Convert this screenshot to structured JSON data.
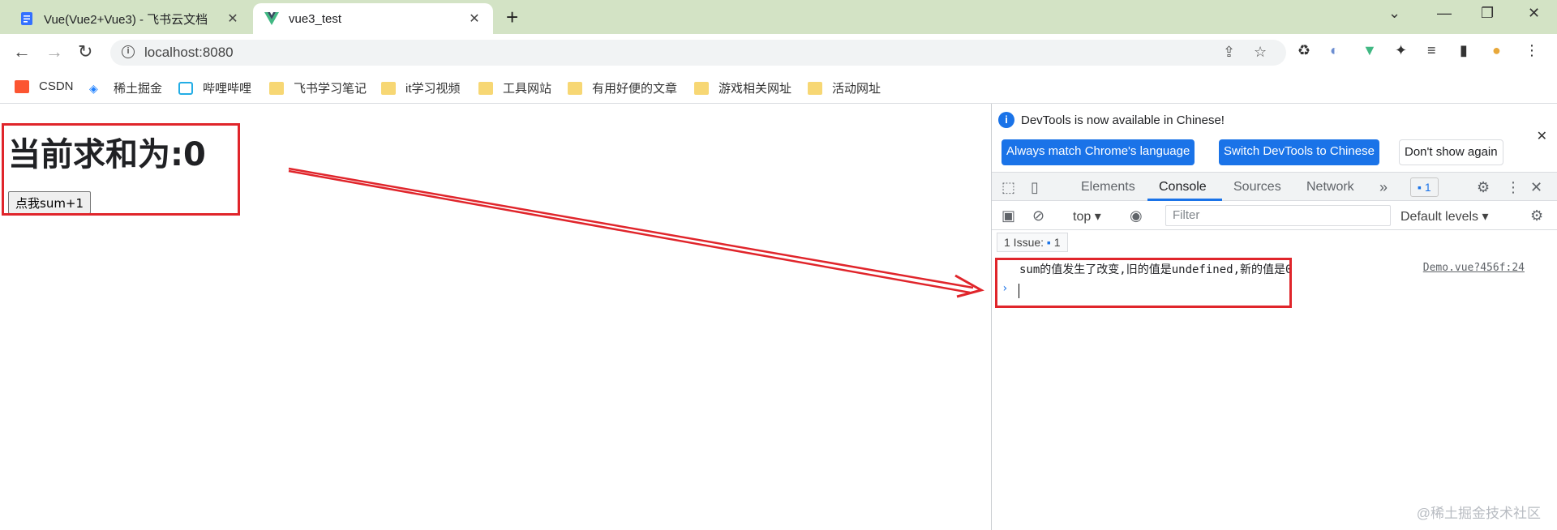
{
  "tabs": [
    {
      "title": "Vue(Vue2+Vue3) - 飞书云文档",
      "active": false
    },
    {
      "title": "vue3_test",
      "active": true
    }
  ],
  "toolbar": {
    "url": "localhost:8080"
  },
  "bookmarks": [
    "CSDN",
    "稀土掘金",
    "哔哩哔哩",
    "飞书学习笔记",
    "it学习视频",
    "工具网站",
    "有用好便的文章",
    "游戏相关网址",
    "活动网址"
  ],
  "page": {
    "heading": "当前求和为:0",
    "button_label": "点我sum+1"
  },
  "devtools": {
    "info_text": "DevTools is now available in Chinese!",
    "btn_match": "Always match Chrome's language",
    "btn_switch": "Switch DevTools to Chinese",
    "btn_dismiss": "Don't show again",
    "tabs": [
      "Elements",
      "Console",
      "Sources",
      "Network"
    ],
    "active_tab": "Console",
    "issue_badge": "1",
    "context": "top",
    "filter_placeholder": "Filter",
    "levels": "Default levels",
    "issues_label": "1 Issue:",
    "issues_count": "1",
    "log_message": "sum的值发生了改变,旧的值是undefined,新的值是0",
    "log_source": "Demo.vue?456f:24"
  },
  "watermark": "@稀土掘金技术社区",
  "colors": {
    "tabstrip": "#d3e3c5",
    "annotation_red": "#e0252b",
    "accent_blue": "#1a73e8"
  }
}
